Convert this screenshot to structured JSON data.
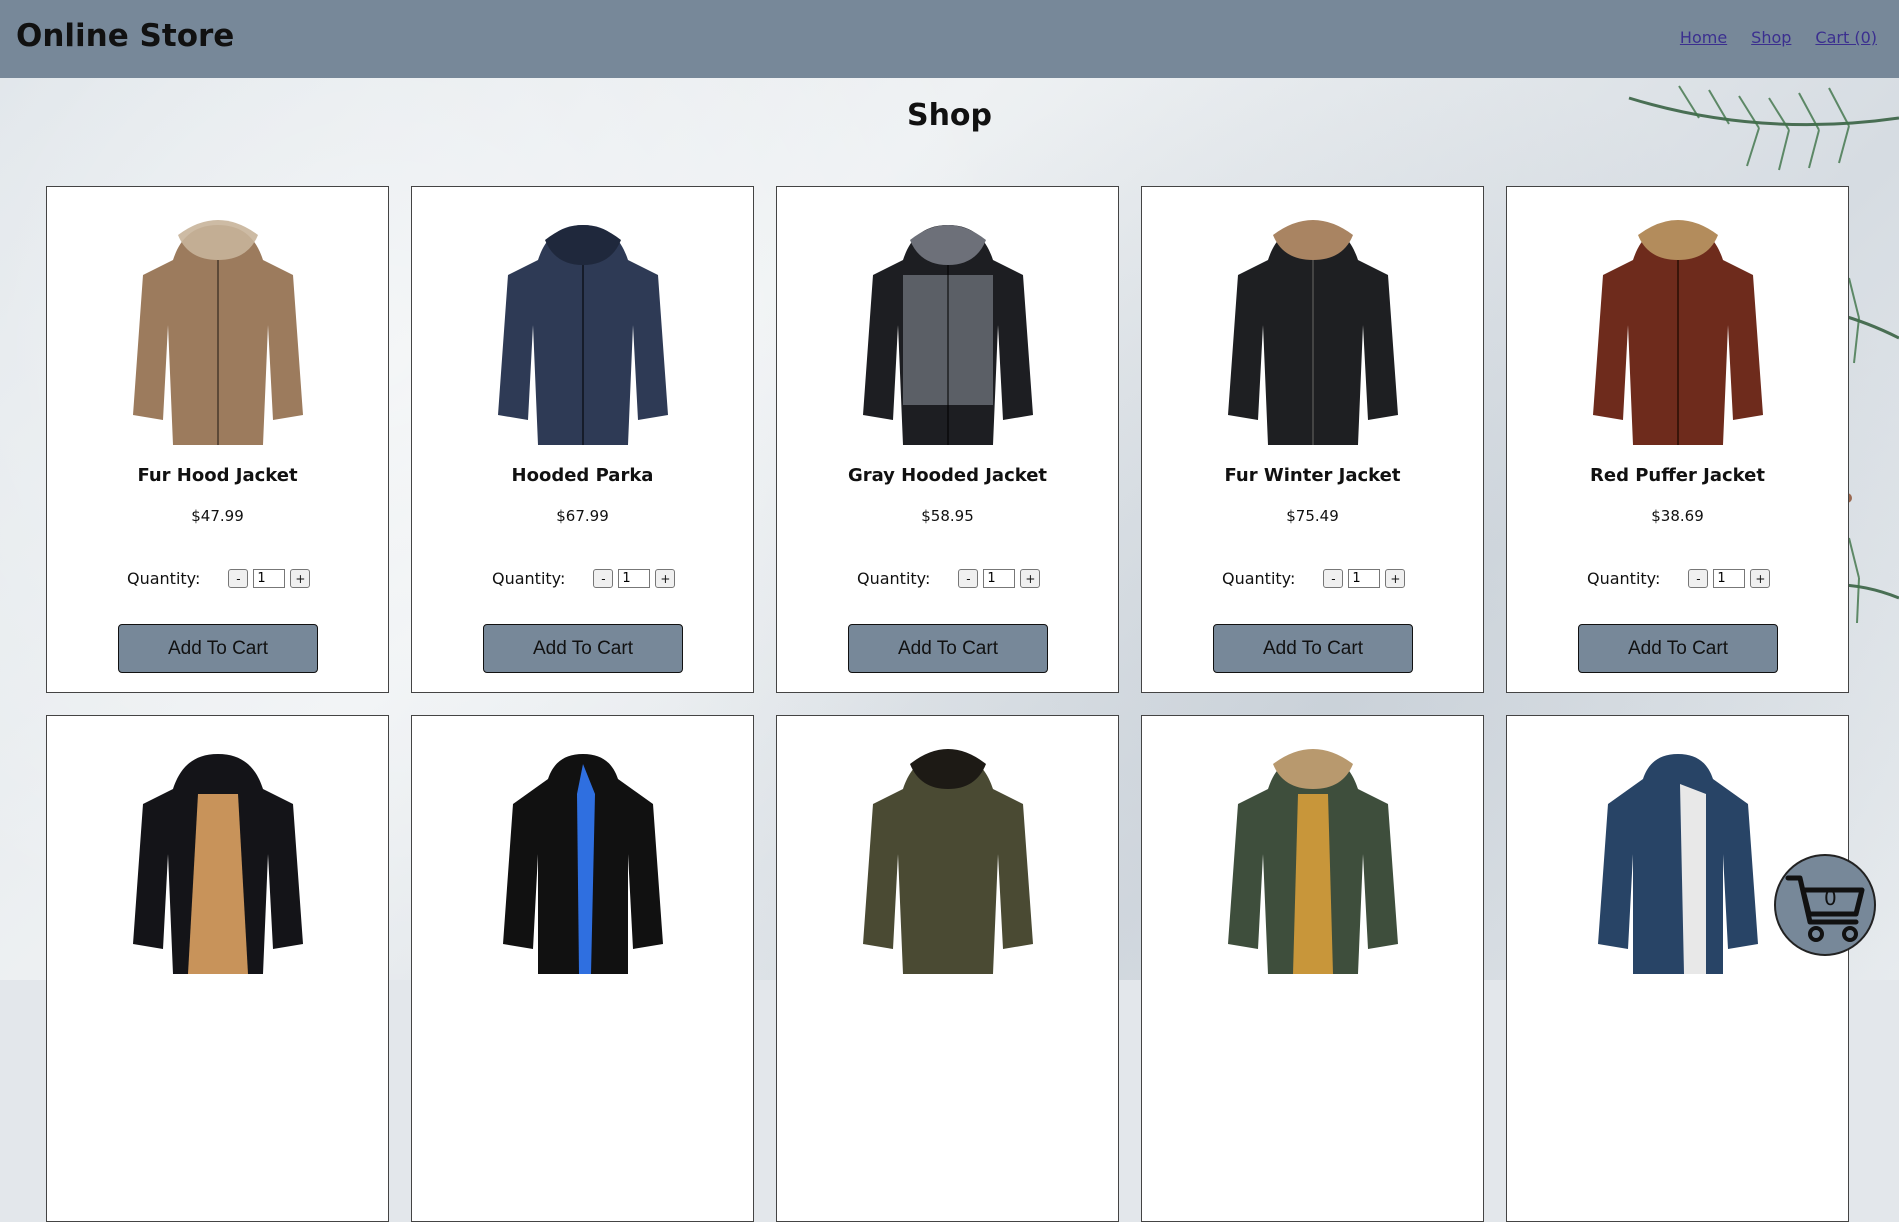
{
  "header": {
    "brand": "Online Store",
    "nav": [
      {
        "label": "Home"
      },
      {
        "label": "Shop"
      },
      {
        "label": "Cart (0)"
      }
    ]
  },
  "page": {
    "title": "Shop"
  },
  "products": [
    {
      "name": "Fur Hood Jacket",
      "price": "$47.99",
      "quantity_label": "Quantity:",
      "quantity": "1",
      "button": "Add To Cart",
      "color": "#9c7b5d"
    },
    {
      "name": "Hooded Parka",
      "price": "$67.99",
      "quantity_label": "Quantity:",
      "quantity": "1",
      "button": "Add To Cart",
      "color": "#2e3a55"
    },
    {
      "name": "Gray Hooded Jacket",
      "price": "$58.95",
      "quantity_label": "Quantity:",
      "quantity": "1",
      "button": "Add To Cart",
      "color": "#5b5f66"
    },
    {
      "name": "Fur Winter Jacket",
      "price": "$75.49",
      "quantity_label": "Quantity:",
      "quantity": "1",
      "button": "Add To Cart",
      "color": "#1e1f22"
    },
    {
      "name": "Red Puffer Jacket",
      "price": "$38.69",
      "quantity_label": "Quantity:",
      "quantity": "1",
      "button": "Add To Cart",
      "color": "#6e2b1c"
    },
    {
      "color": "#141418"
    },
    {
      "color": "#111111"
    },
    {
      "color": "#4a4a33"
    },
    {
      "color": "#3e4e3c"
    },
    {
      "color": "#284466"
    }
  ],
  "floating_cart": {
    "count": "0",
    "icon": "cart-icon"
  },
  "colors": {
    "header": "#778899",
    "button": "#778899"
  }
}
